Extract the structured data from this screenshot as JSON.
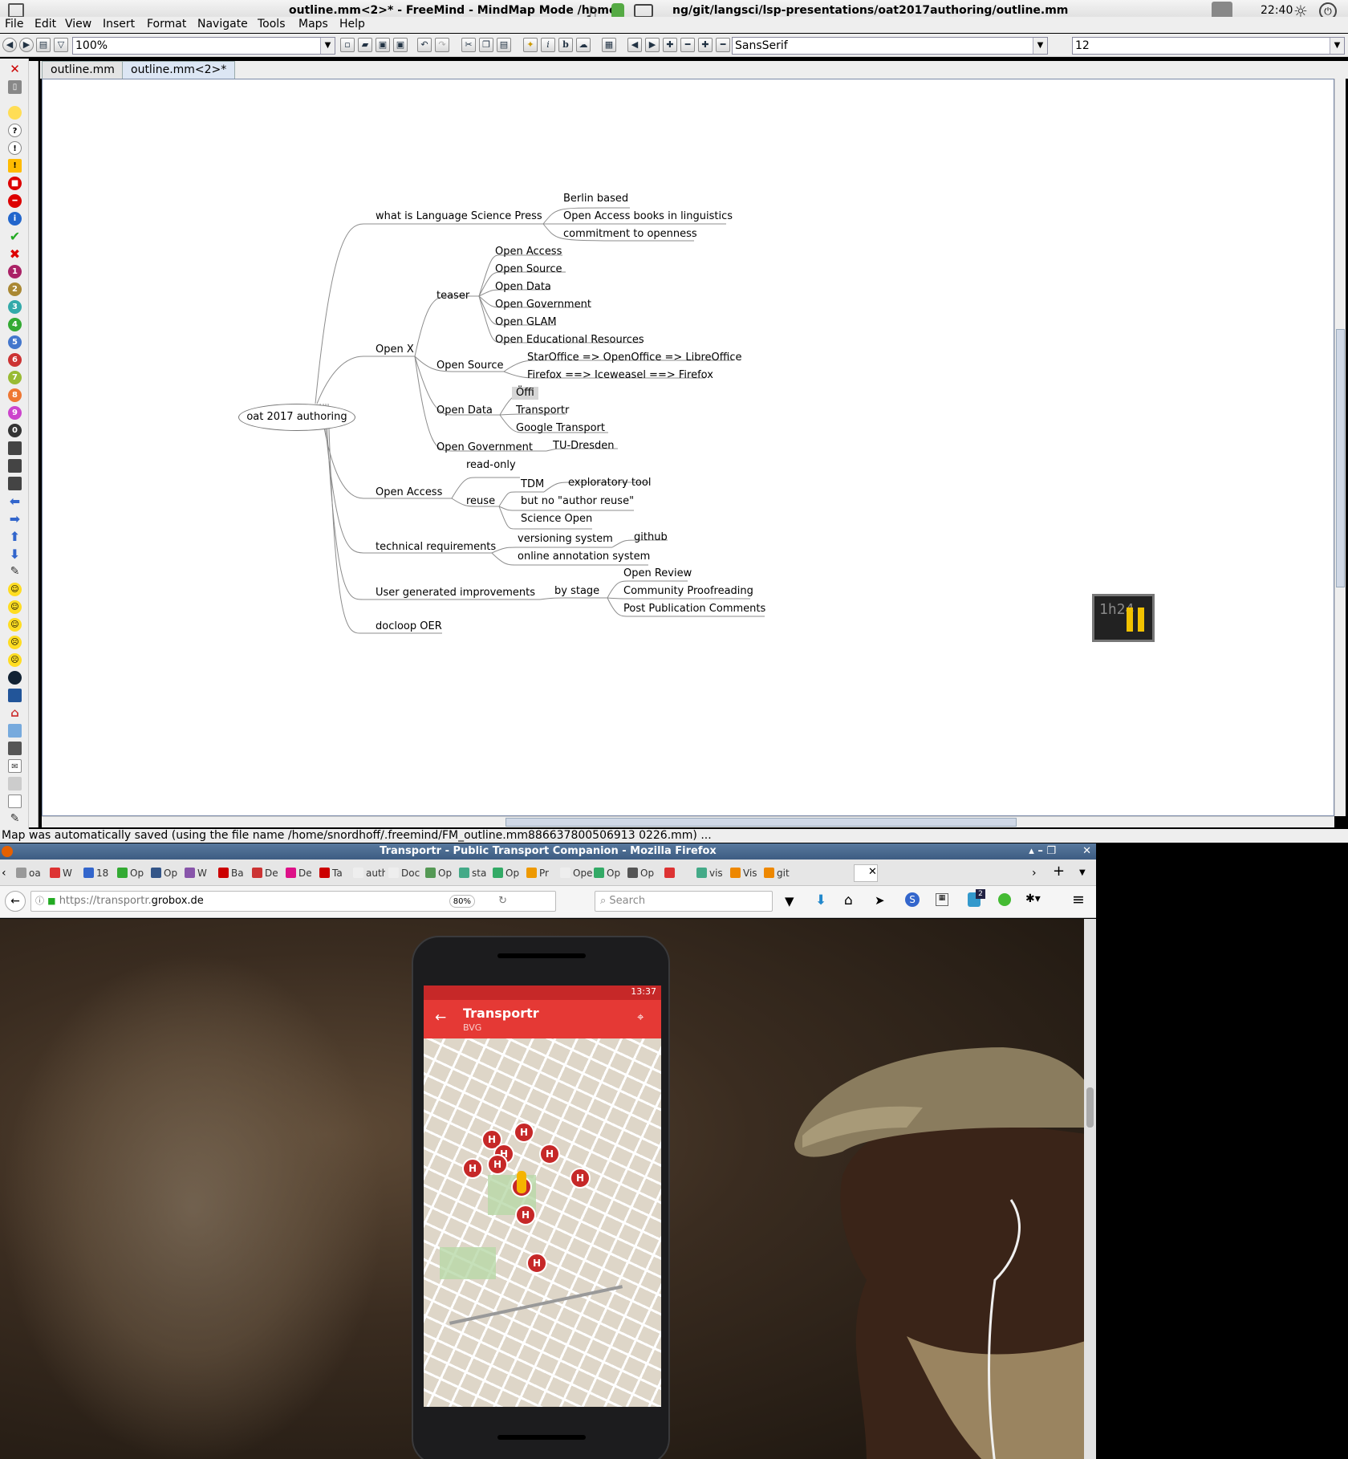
{
  "freemind": {
    "window_title": "outline.mm<2>* - FreeMind - MindMap Mode /home/...ng/git/langsci/lsp-presentations/oat2017authoring/outline.mm",
    "title_left": "outline.mm<2>* - FreeMind - MindMap Mode /home,",
    "title_right": "ng/git/langsci/lsp-presentations/oat2017authoring/outline.mm",
    "clock": "22:40",
    "menu": [
      "File",
      "Edit",
      "View",
      "Insert",
      "Format",
      "Navigate",
      "Tools",
      "Maps",
      "Help"
    ],
    "zoom": "100%",
    "font": "SansSerif",
    "font_size": "12",
    "tabs": [
      "outline.mm",
      "outline.mm<2>*"
    ],
    "status": "Map was automatically saved (using the file name /home/snordhoff/.freemind/FM_outline.mm886637800506913 0226.mm) ...",
    "mindmap": {
      "root": "oat 2017 authoring",
      "n_lsp": "what is Language Science Press",
      "n_berlin": "Berlin based",
      "n_oabooks": "Open Access books in linguistics",
      "n_commit": "commitment to openness",
      "n_openx": "Open X",
      "n_teaser": "teaser",
      "t_oa": "Open Access",
      "t_os": "Open Source",
      "t_od": "Open Data",
      "t_og": "Open Government",
      "t_glam": "Open GLAM",
      "t_oer": "Open Educational Resources",
      "n_opensource": "Open Source",
      "os1": "StarOffice => OpenOffice => LibreOffice",
      "os2": "Firefox ==> Iceweasel ==> Firefox",
      "n_opendata": "Open Data",
      "od1": "Öffi",
      "od2": "Transportr",
      "od3": "Google Transport",
      "n_opengov": "Open Government",
      "og1": "TU-Dresden",
      "n_openaccess": "Open Access",
      "oa_ro": "read-only",
      "oa_reuse": "reuse",
      "tdm": "TDM",
      "tdm1": "exploratory tool",
      "noauthor": "but no \"author reuse\"",
      "sciopen": "Science Open",
      "n_tech": "technical requirements",
      "tech1": "versioning system",
      "tech1a": "github",
      "tech2": "online annotation system",
      "n_ugi": "User generated improvements",
      "bystage": "by stage",
      "st1": "Open Review",
      "st2": "Community Proofreading",
      "st3": "Post Publication Comments",
      "n_docloop": "docloop OER"
    }
  },
  "firefox": {
    "title": "Transportr - Public Transport Companion - Mozilla Firefox",
    "tabs": [
      {
        "label": "oa",
        "color": "#999"
      },
      {
        "label": "W",
        "color": "#d33"
      },
      {
        "label": "18",
        "color": "#36c"
      },
      {
        "label": "Op",
        "color": "#3a3"
      },
      {
        "label": "Op",
        "color": "#358"
      },
      {
        "label": "W",
        "color": "#85a"
      },
      {
        "label": "Ba",
        "color": "#c00"
      },
      {
        "label": "De",
        "color": "#c33"
      },
      {
        "label": "De",
        "color": "#d18"
      },
      {
        "label": "Ta",
        "color": "#c00"
      },
      {
        "label": "author",
        "color": "#eee"
      },
      {
        "label": "Docun",
        "color": "#eee"
      },
      {
        "label": "Op",
        "color": "#595"
      },
      {
        "label": "sta",
        "color": "#4a8"
      },
      {
        "label": "Op",
        "color": "#3a6"
      },
      {
        "label": "Pr",
        "color": "#e90"
      },
      {
        "label": "OpenS",
        "color": "#eee"
      },
      {
        "label": "Op",
        "color": "#3a6"
      },
      {
        "label": "Op",
        "color": "#555"
      },
      {
        "label": "",
        "color": "#d33"
      },
      {
        "label": "vis",
        "color": "#4a8"
      },
      {
        "label": "Vis",
        "color": "#e80"
      },
      {
        "label": "git",
        "color": "#e80"
      }
    ],
    "url_prefix": "https://transportr.",
    "url_domain": "grobox.de",
    "zoom": "80%",
    "search_placeholder": "Search",
    "notif_count": "2"
  },
  "phone": {
    "time": "13:37",
    "app_title": "Transportr",
    "app_subtitle": "BVG",
    "pin_glyph": "H"
  },
  "badge": "1h24"
}
